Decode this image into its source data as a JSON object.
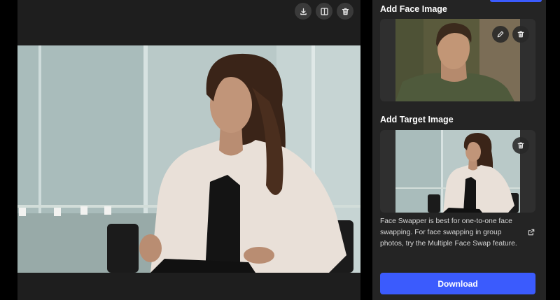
{
  "toolbar": {
    "download_icon": "download-icon",
    "compare_icon": "split-view-icon",
    "delete_icon": "trash-icon"
  },
  "face_section": {
    "title": "Add Face Image",
    "edit_icon": "pencil-icon",
    "delete_icon": "trash-icon"
  },
  "target_section": {
    "title": "Add Target Image",
    "delete_icon": "trash-icon"
  },
  "info": {
    "text": "Face Swapper is best for one-to-one face swapping. For face swapping in group photos, try the Multiple Face Swap feature.",
    "link_icon": "external-link-icon"
  },
  "download_button": {
    "label": "Download"
  },
  "colors": {
    "accent": "#3b5bfd",
    "panel": "#242424",
    "card": "#2f2f2f"
  }
}
